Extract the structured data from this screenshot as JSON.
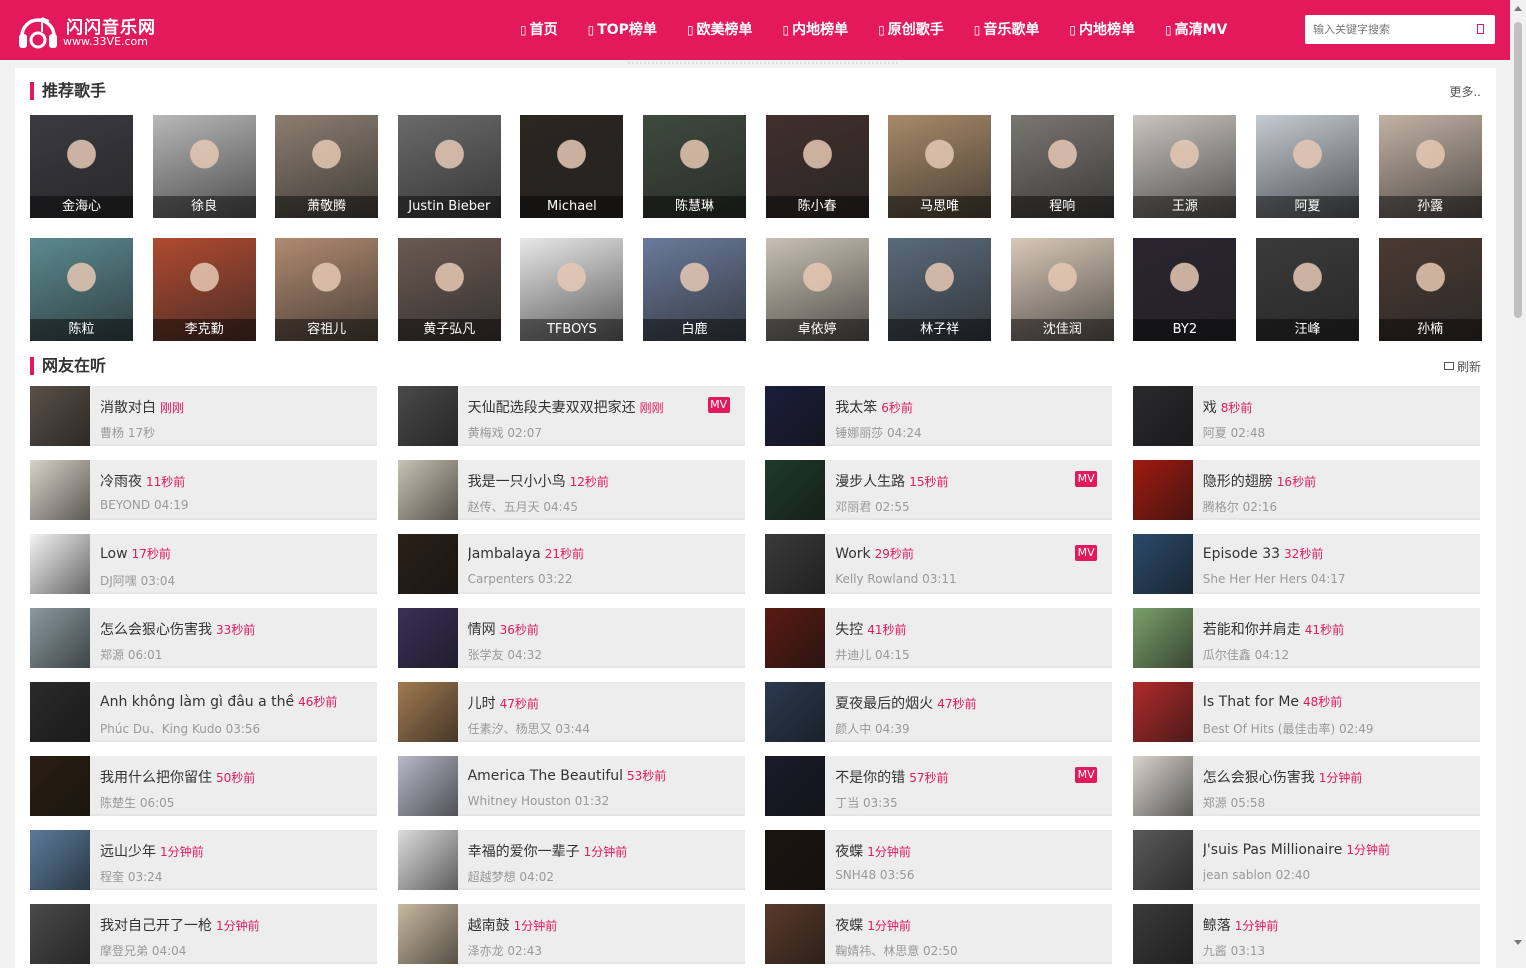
{
  "header": {
    "logo_name": "闪闪音乐网",
    "logo_url": "www.33VE.com",
    "brand_color": "#e3195b",
    "nav": [
      {
        "icon": "home-icon",
        "label": "首页"
      },
      {
        "icon": "chart-icon",
        "label": "TOP榜单"
      },
      {
        "icon": "chart-icon",
        "label": "欧美榜单"
      },
      {
        "icon": "chart-icon",
        "label": "内地榜单"
      },
      {
        "icon": "mic-icon",
        "label": "原创歌手"
      },
      {
        "icon": "list-icon",
        "label": "音乐歌单"
      },
      {
        "icon": "chart-icon",
        "label": "内地榜单"
      },
      {
        "icon": "video-icon",
        "label": "高清MV"
      }
    ],
    "search": {
      "placeholder": "输入关键字搜索",
      "value": ""
    }
  },
  "singers_section": {
    "title": "推荐歌手",
    "more": "更多..",
    "singers": [
      {
        "name": "金海心",
        "color": "#3a3a40"
      },
      {
        "name": "徐良",
        "color": "#b8b8b8"
      },
      {
        "name": "萧敬腾",
        "color": "#8c7e70"
      },
      {
        "name": "Justin Bieber",
        "color": "#6a6a6a"
      },
      {
        "name": "Michael",
        "color": "#2a2620"
      },
      {
        "name": "陈慧琳",
        "color": "#3e4a3e"
      },
      {
        "name": "陈小春",
        "color": "#40302c"
      },
      {
        "name": "马思唯",
        "color": "#a88a68"
      },
      {
        "name": "程响",
        "color": "#7a7672"
      },
      {
        "name": "王源",
        "color": "#c8c4be"
      },
      {
        "name": "阿夏",
        "color": "#c4cbd2"
      },
      {
        "name": "孙露",
        "color": "#c2b2a4"
      },
      {
        "name": "陈粒",
        "color": "#5a8a90"
      },
      {
        "name": "李克勤",
        "color": "#b04a30"
      },
      {
        "name": "容祖儿",
        "color": "#b08a70"
      },
      {
        "name": "黄子弘凡",
        "color": "#6a5a52"
      },
      {
        "name": "TFBOYS",
        "color": "#e8e8e8"
      },
      {
        "name": "白鹿",
        "color": "#6a7a9a"
      },
      {
        "name": "卓依婷",
        "color": "#c8c0b2"
      },
      {
        "name": "林子祥",
        "color": "#5a6a7a"
      },
      {
        "name": "沈佳润",
        "color": "#d8c8b8"
      },
      {
        "name": "BY2",
        "color": "#2a2430"
      },
      {
        "name": "汪峰",
        "color": "#3a3a3a"
      },
      {
        "name": "孙楠",
        "color": "#4a3a32"
      }
    ]
  },
  "songs_section": {
    "title": "网友在听",
    "refresh": "刷新",
    "songs": [
      {
        "title": "消散对白",
        "time": "刚刚",
        "meta": "曹杨 17秒",
        "mv": false,
        "color": "#5a5048"
      },
      {
        "title": "天仙配选段夫妻双双把家还",
        "time": "刚刚",
        "meta": "黄梅戏 02:07",
        "mv": true,
        "color": "#4a4a4a"
      },
      {
        "title": "我太笨",
        "time": "6秒前",
        "meta": "锤娜丽莎 04:24",
        "mv": false,
        "color": "#1a1e3a"
      },
      {
        "title": "戏",
        "time": "8秒前",
        "meta": "阿夏 02:48",
        "mv": false,
        "color": "#2a2a2e"
      },
      {
        "title": "冷雨夜",
        "time": "11秒前",
        "meta": "BEYOND 04:19",
        "mv": false,
        "color": "#d8d2c8"
      },
      {
        "title": "我是一只小小鸟",
        "time": "12秒前",
        "meta": "赵传、五月天 04:45",
        "mv": false,
        "color": "#c8c2b2"
      },
      {
        "title": "漫步人生路",
        "time": "15秒前",
        "meta": "邓丽君 02:55",
        "mv": true,
        "color": "#1e3a2a"
      },
      {
        "title": "隐形的翅膀",
        "time": "16秒前",
        "meta": "腾格尔 02:16",
        "mv": false,
        "color": "#a01a10"
      },
      {
        "title": "Low",
        "time": "17秒前",
        "meta": "DJ阿嘿 03:04",
        "mv": false,
        "color": "#f4f4f4"
      },
      {
        "title": "Jambalaya",
        "time": "21秒前",
        "meta": "Carpenters 03:22",
        "mv": false,
        "color": "#2a2018"
      },
      {
        "title": "Work",
        "time": "29秒前",
        "meta": "Kelly Rowland 03:11",
        "mv": true,
        "color": "#3a3a3a"
      },
      {
        "title": "Episode 33",
        "time": "32秒前",
        "meta": "She Her Her Hers 04:17",
        "mv": false,
        "color": "#2a4a6a"
      },
      {
        "title": "怎么会狠心伤害我",
        "time": "33秒前",
        "meta": "郑源 06:01",
        "mv": false,
        "color": "#8a9aa0"
      },
      {
        "title": "情网",
        "time": "36秒前",
        "meta": "张学友 04:32",
        "mv": false,
        "color": "#3a3058"
      },
      {
        "title": "失控",
        "time": "41秒前",
        "meta": "井迪儿 04:15",
        "mv": false,
        "color": "#5a1a12"
      },
      {
        "title": "若能和你并肩走",
        "time": "41秒前",
        "meta": "瓜尔佳鑫 04:12",
        "mv": false,
        "color": "#7aa06a"
      },
      {
        "title": "Anh không làm gì đâu a thề",
        "time": "46秒前",
        "meta": "Phúc Du、King Kudo 03:56",
        "mv": false,
        "color": "#2a2a2a"
      },
      {
        "title": "儿时",
        "time": "47秒前",
        "meta": "任素汐、杨思又 03:44",
        "mv": false,
        "color": "#a07a50"
      },
      {
        "title": "夏夜最后的烟火",
        "time": "47秒前",
        "meta": "颜人中 04:39",
        "mv": false,
        "color": "#2a3a50"
      },
      {
        "title": "Is That for Me",
        "time": "48秒前",
        "meta": "Best Of Hits (最佳击率) 02:49",
        "mv": false,
        "color": "#b02a2a"
      },
      {
        "title": "我用什么把你留住",
        "time": "50秒前",
        "meta": "陈楚生 06:05",
        "mv": false,
        "color": "#2a1e10"
      },
      {
        "title": "America The Beautiful",
        "time": "53秒前",
        "meta": "Whitney Houston 01:32",
        "mv": false,
        "color": "#b8b8c8"
      },
      {
        "title": "不是你的错",
        "time": "57秒前",
        "meta": "丁当 03:35",
        "mv": true,
        "color": "#1a1a2a"
      },
      {
        "title": "怎么会狠心伤害我",
        "time": "1分钟前",
        "meta": "郑源 05:58",
        "mv": false,
        "color": "#d8d4cc"
      },
      {
        "title": "远山少年",
        "time": "1分钟前",
        "meta": "程奎 03:24",
        "mv": false,
        "color": "#5a7a9a"
      },
      {
        "title": "幸福的爱你一辈子",
        "time": "1分钟前",
        "meta": "超越梦想 04:02",
        "mv": false,
        "color": "#dcdcdc"
      },
      {
        "title": "夜蝶",
        "time": "1分钟前",
        "meta": "SNH48 03:56",
        "mv": false,
        "color": "#1a140e"
      },
      {
        "title": "J'suis Pas Millionaire",
        "time": "1分钟前",
        "meta": "jean sablon 02:40",
        "mv": false,
        "color": "#5a5a5a"
      },
      {
        "title": "我对自己开了一枪",
        "time": "1分钟前",
        "meta": "摩登兄弟 04:04",
        "mv": false,
        "color": "#4a4a4a"
      },
      {
        "title": "越南鼓",
        "time": "1分钟前",
        "meta": "泽亦龙 02:43",
        "mv": false,
        "color": "#c8b8a0"
      },
      {
        "title": "夜蝶",
        "time": "1分钟前",
        "meta": "鞠婧祎、林思意 02:50",
        "mv": false,
        "color": "#5a3a2a"
      },
      {
        "title": "鲸落",
        "time": "1分钟前",
        "meta": "九酱 03:13",
        "mv": false,
        "color": "#3a3a3a"
      }
    ],
    "mv_label": "MV"
  }
}
